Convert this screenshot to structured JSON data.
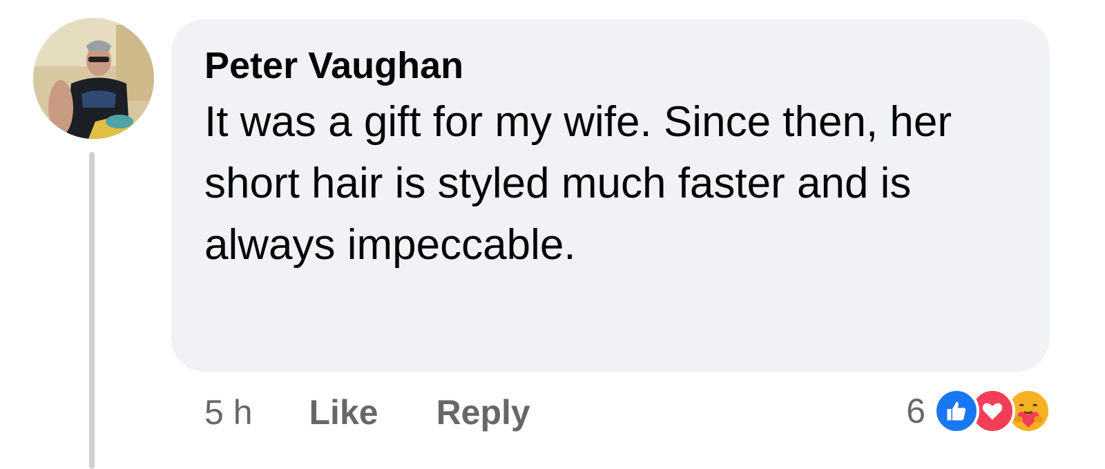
{
  "comment": {
    "author": "Peter Vaughan",
    "text": "It was a gift for my wife. Since then, her short hair is styled much faster and is always impeccable.",
    "timestamp": "5 h",
    "like_label": "Like",
    "reply_label": "Reply",
    "reaction_count": "6",
    "reactions": [
      "like-icon",
      "love-icon",
      "care-icon"
    ]
  },
  "colors": {
    "bubble": "#f0f2f5",
    "text": "#050505",
    "secondary_text": "#65676b",
    "like": "#1877f2",
    "love": "#f33e58",
    "care": "#f7b125"
  }
}
